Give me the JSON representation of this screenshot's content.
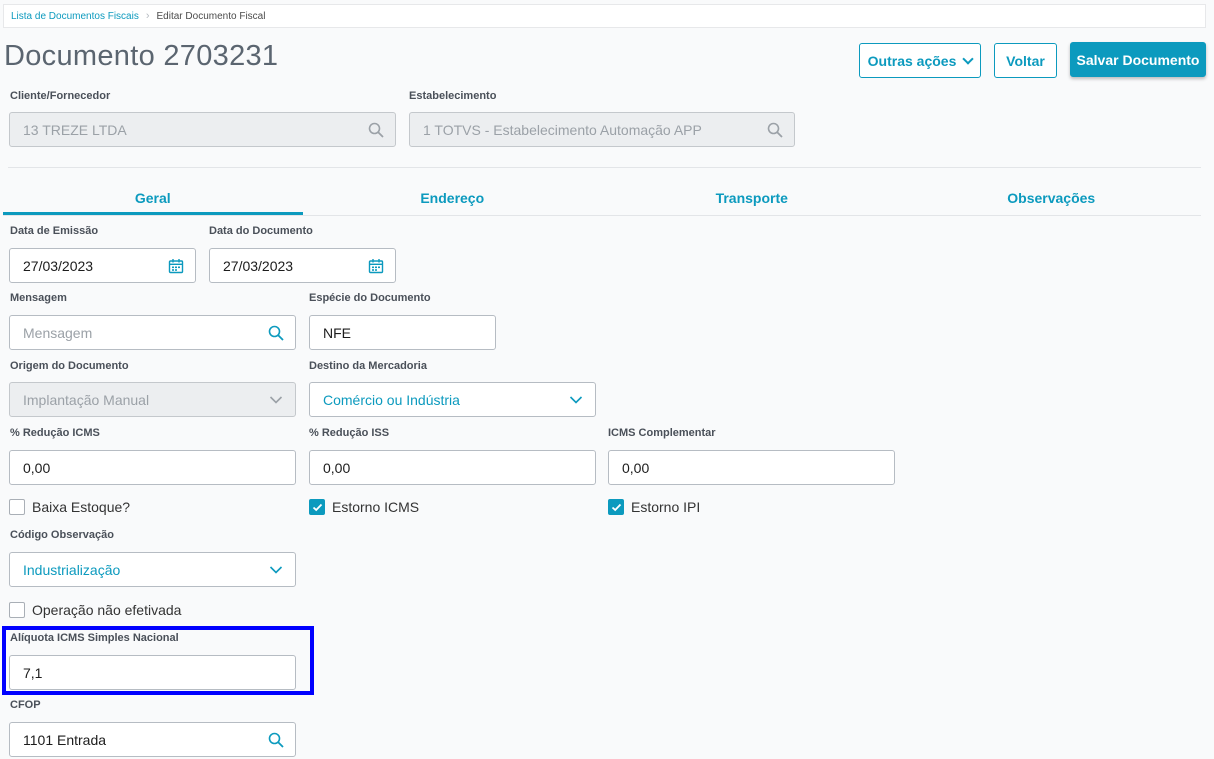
{
  "breadcrumb": {
    "link": "Lista de Documentos Fiscais",
    "current": "Editar Documento Fiscal"
  },
  "header": {
    "title": "Documento 2703231",
    "actions": {
      "more": "Outras ações",
      "back": "Voltar",
      "save": "Salvar Documento"
    }
  },
  "top_fields": {
    "cliente": {
      "label": "Cliente/Fornecedor",
      "value": "13  TREZE LTDA"
    },
    "estab": {
      "label": "Estabelecimento",
      "value": "1  TOTVS - Estabelecimento Automação APP"
    }
  },
  "tabs": [
    {
      "label": "Geral",
      "active": true
    },
    {
      "label": "Endereço"
    },
    {
      "label": "Transporte"
    },
    {
      "label": "Observações"
    }
  ],
  "form": {
    "data_emissao": {
      "label": "Data de Emissão",
      "value": "27/03/2023"
    },
    "data_documento": {
      "label": "Data do Documento",
      "value": "27/03/2023"
    },
    "mensagem": {
      "label": "Mensagem",
      "placeholder": "Mensagem"
    },
    "especie": {
      "label": "Espécie do Documento",
      "value": "NFE"
    },
    "origem": {
      "label": "Origem do Documento",
      "value": "Implantação Manual"
    },
    "destino": {
      "label": "Destino da Mercadoria",
      "value": "Comércio ou Indústria"
    },
    "reducao_icms": {
      "label": "% Redução ICMS",
      "value": "0,00"
    },
    "reducao_iss": {
      "label": "% Redução ISS",
      "value": "0,00"
    },
    "icms_comp": {
      "label": "ICMS Complementar",
      "value": "0,00"
    },
    "baixa_estoque": {
      "label": "Baixa Estoque?",
      "checked": false
    },
    "estorno_icms": {
      "label": "Estorno ICMS",
      "checked": true
    },
    "estorno_ipi": {
      "label": "Estorno IPI",
      "checked": true
    },
    "codigo_obs": {
      "label": "Código Observação",
      "value": "Industrialização"
    },
    "operacao": {
      "label": "Operação não efetivada",
      "checked": false
    },
    "aliquota": {
      "label": "Alíquota ICMS Simples Nacional",
      "value": "7,1"
    },
    "cfop": {
      "label": "CFOP",
      "value": "1101  Entrada"
    }
  },
  "colors": {
    "accent": "#0c9abe",
    "highlight": "#0000ff"
  }
}
